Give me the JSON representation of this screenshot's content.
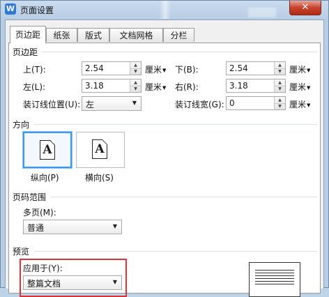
{
  "window": {
    "title": "页面设置",
    "app_icon": "W",
    "close_label": "✕"
  },
  "tabs": [
    {
      "label": "页边距",
      "active": true
    },
    {
      "label": "纸张",
      "active": false
    },
    {
      "label": "版式",
      "active": false
    },
    {
      "label": "文档网格",
      "active": false
    },
    {
      "label": "分栏",
      "active": false
    }
  ],
  "margins": {
    "group_title": "页边距",
    "top": {
      "label": "上(T):",
      "value": "2.54",
      "unit": "厘米"
    },
    "bottom": {
      "label": "下(B):",
      "value": "2.54",
      "unit": "厘米"
    },
    "left": {
      "label": "左(L):",
      "value": "3.18",
      "unit": "厘米"
    },
    "right": {
      "label": "右(R):",
      "value": "3.18",
      "unit": "厘米"
    },
    "gutter_position": {
      "label": "装订线位置(U):",
      "value": "左"
    },
    "gutter": {
      "label": "装订线宽(G):",
      "value": "0",
      "unit": "厘米"
    }
  },
  "orientation": {
    "group_title": "方向",
    "portrait": {
      "label": "纵向(P)",
      "glyph": "A",
      "selected": true
    },
    "landscape": {
      "label": "横向(S)",
      "glyph": "A",
      "selected": false
    }
  },
  "page_range": {
    "group_title": "页码范围",
    "multiple_pages": {
      "label": "多页(M):",
      "value": "普通"
    }
  },
  "preview": {
    "group_title": "预览",
    "apply_to": {
      "label": "应用于(Y):",
      "value": "整篇文档"
    }
  },
  "colors": {
    "accent": "#3399ff",
    "highlight": "#d9333a",
    "close": "#c7432d"
  }
}
